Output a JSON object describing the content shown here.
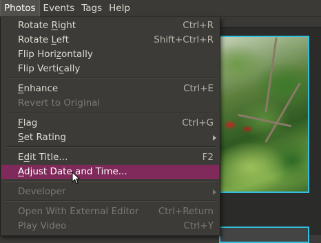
{
  "menubar": {
    "items": [
      "Photos",
      "Events",
      "Tags",
      "Help"
    ]
  },
  "photos_menu": {
    "rotate_right": {
      "label_pre": "Rotate ",
      "label_mn": "R",
      "label_post": "ight",
      "accel": "Ctrl+R"
    },
    "rotate_left": {
      "label_pre": "Rotate ",
      "label_mn": "L",
      "label_post": "eft",
      "accel": "Shift+Ctrl+R"
    },
    "flip_horizontally": {
      "label_pre": "Flip Hori",
      "label_mn": "z",
      "label_post": "ontally"
    },
    "flip_vertically": {
      "label_pre": "Flip Verti",
      "label_mn": "c",
      "label_post": "ally"
    },
    "enhance": {
      "label_pre": "",
      "label_mn": "E",
      "label_post": "nhance",
      "accel": "Ctrl+E"
    },
    "revert": {
      "label": "Revert to Original"
    },
    "flag": {
      "label_pre": "",
      "label_mn": "F",
      "label_post": "lag",
      "accel": "Ctrl+G"
    },
    "set_rating": {
      "label_pre": "",
      "label_mn": "S",
      "label_post": "et Rating"
    },
    "edit_title": {
      "label_pre": "E",
      "label_mn": "d",
      "label_post": "it Title...",
      "accel": "F2"
    },
    "adjust_date": {
      "label_pre": "",
      "label_mn": "A",
      "label_post": "djust Date and Time..."
    },
    "developer": {
      "label": "Developer"
    },
    "open_external": {
      "label": "Open With External Editor",
      "accel": "Ctrl+Return"
    },
    "play_video": {
      "label": "Play Video",
      "accel": "Ctrl+Y"
    }
  },
  "colors": {
    "highlight": "#7f2a5a",
    "menu_bg": "#3c3b37",
    "selection_border": "#33c0e0"
  }
}
